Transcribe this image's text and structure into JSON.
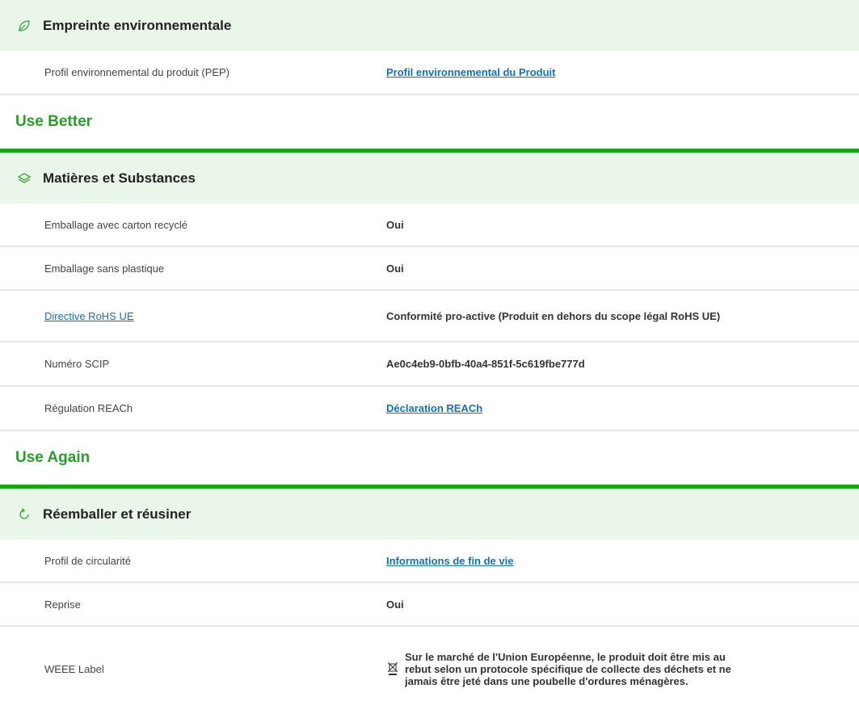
{
  "sections": {
    "empreinte": {
      "title": "Empreinte environnementale",
      "icon": "leaf-icon",
      "rows": [
        {
          "label": "Profil environnemental du produit (PEP)",
          "value": "Profil environnemental du Produit"
        }
      ]
    },
    "use_better": {
      "group_title": "Use Better"
    },
    "matieres": {
      "title": "Matières et Substances",
      "icon": "layers-icon",
      "rows": [
        {
          "label": "Emballage avec carton recyclé",
          "value": "Oui"
        },
        {
          "label": "Emballage sans plastique",
          "value": "Oui"
        },
        {
          "label": "Directive RoHS UE",
          "value": "Conformité pro-active (Produit en dehors du scope légal RoHS UE)"
        },
        {
          "label": "Numéro SCIP",
          "value": "Ae0c4eb9-0bfb-40a4-851f-5c619fbe777d"
        },
        {
          "label": "Régulation REACh",
          "value": "Déclaration REACh"
        }
      ]
    },
    "use_again": {
      "group_title": "Use Again"
    },
    "reemballer": {
      "title": "Réemballer et réusiner",
      "icon": "refresh-icon",
      "rows": [
        {
          "label": "Profil de circularité",
          "value": "Informations de fin de vie"
        },
        {
          "label": "Reprise",
          "value": "Oui"
        },
        {
          "label": "WEEE Label",
          "value": "Sur le marché de l'Union Européenne, le produit doit être mis au rebut selon un protocole spécifique de collecte des déchets et ne jamais être jeté dans une poubelle d'ordures ménagères."
        }
      ]
    }
  },
  "colors": {
    "header_bg": "#eaf6ea",
    "group_title": "#2c9b2c",
    "group_rule": "#1aa11a",
    "link": "#1a6fa8"
  }
}
